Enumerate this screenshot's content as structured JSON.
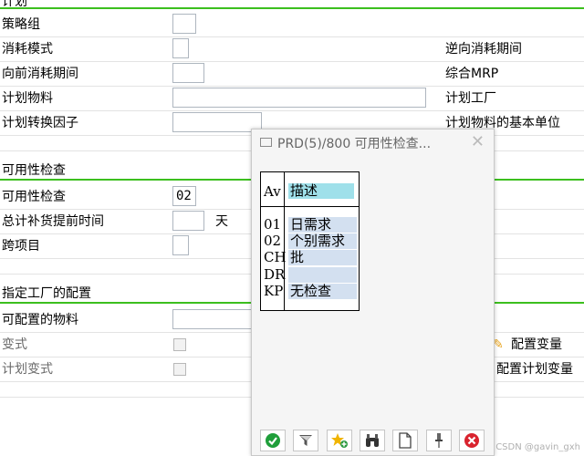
{
  "top_section": {
    "title": "计划",
    "rows": [
      {
        "label": "策略组",
        "value": "",
        "right_label": ""
      },
      {
        "label": "消耗模式",
        "value": "",
        "right_label": "逆向消耗期间"
      },
      {
        "label": "向前消耗期间",
        "value": "",
        "right_label": "综合MRP"
      },
      {
        "label": "计划物料",
        "value": "",
        "right_label": "计划工厂"
      },
      {
        "label": "计划转换因子",
        "value": "",
        "right_label": "计划物料的基本单位"
      }
    ]
  },
  "availability_section": {
    "title": "可用性检查",
    "rows": [
      {
        "label": "可用性检查",
        "value": "02"
      },
      {
        "label": "总计补货提前时间",
        "value": "",
        "unit": "天"
      },
      {
        "label": "跨项目",
        "value": ""
      }
    ]
  },
  "config_section": {
    "title": "指定工厂的配置",
    "rows": [
      {
        "label": "可配置的物料",
        "value": ""
      },
      {
        "label": "变式",
        "disabled": true
      },
      {
        "label": "计划变式",
        "disabled": true
      }
    ],
    "buttons": {
      "config_variant": "配置变量",
      "config_plan_variant": "配置计划变量"
    }
  },
  "dialog": {
    "title": "PRD(5)/800 可用性检查...",
    "header": {
      "code": "Av",
      "desc": "描述"
    },
    "items": [
      {
        "code": "01",
        "desc": "日需求"
      },
      {
        "code": "02",
        "desc": "个别需求"
      },
      {
        "code": "CH",
        "desc": "批"
      },
      {
        "code": "DR",
        "desc": ""
      },
      {
        "code": "KP",
        "desc": "无检查"
      }
    ],
    "toolbar": [
      "confirm-icon",
      "filter-icon",
      "add-favorite-icon",
      "find-icon",
      "new-document-icon",
      "pin-icon",
      "cancel-icon"
    ]
  },
  "watermark": "CSDN @gavin_gxh",
  "colors": {
    "section_line": "#3cbf1e",
    "highlight": "#9fe0ea",
    "row_bg": "#d3e0f0",
    "cancel": "#d9232e",
    "confirm": "#1f9e3a"
  }
}
